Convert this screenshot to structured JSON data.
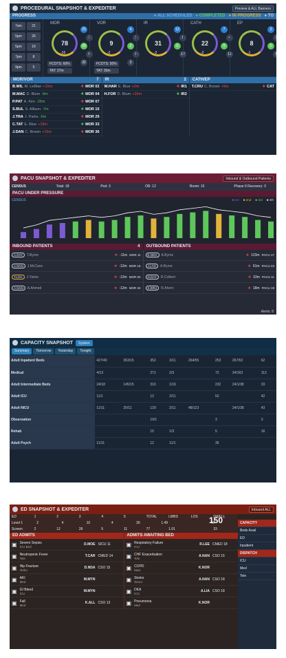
{
  "p1": {
    "title": "PROCEDURAL SNAPSHOT & EXPEDITER",
    "btn": "Preview & ALL Banners",
    "section": "PROGRESS",
    "legend": [
      "ALL SCHEDULED",
      "COMPLETED",
      "IN PROGRESS",
      "TO"
    ],
    "times": [
      [
        "7am",
        "21"
      ],
      [
        "5pm",
        "26"
      ],
      [
        "5pm",
        "16"
      ],
      [
        "7pm",
        "8"
      ],
      [
        "9pm",
        "5"
      ]
    ],
    "units": [
      {
        "name": "MOR",
        "value": "78",
        "sub": "-16",
        "chips": [
          "20",
          "1",
          "26",
          "6",
          "32"
        ],
        "tags": [
          "FCOTS: 60%",
          "TAT: 37m"
        ]
      },
      {
        "name": "VOR",
        "value": "9",
        "sub": "-2",
        "chips": [
          "4",
          "1",
          "2",
          "0",
          "3"
        ],
        "tags": [
          "FCOTS: 50%",
          "TAT: 36m"
        ]
      },
      {
        "name": "IR",
        "value": "31",
        "sub": "-2",
        "chips": [
          "12",
          "5",
          "0",
          "17"
        ],
        "tags": []
      },
      {
        "name": "CATH",
        "value": "22",
        "sub": "-2",
        "chips": [
          "7",
          "4",
          "0",
          "11"
        ],
        "tags": []
      },
      {
        "name": "EP",
        "value": "8",
        "sub": "-1",
        "chips": [
          "3",
          "1",
          "0",
          "5"
        ],
        "tags": []
      }
    ],
    "cols": [
      {
        "head": "MOR/VOR",
        "count": "7",
        "rows": [
          {
            "id": "B.WIL",
            "doc": "M. LeBlan",
            "t": "+15m",
            "room": "MOR 02"
          },
          {
            "id": "M.MAC",
            "doc": "D. Blum",
            "t": "-9m",
            "room": "MOR 04"
          },
          {
            "id": "P.PAT",
            "doc": "A. Kim",
            "t": "-25m",
            "room": "MOR 07"
          },
          {
            "id": "S.BUL",
            "doc": "S. Allison",
            "t": "-7m",
            "room": "MOR 15"
          },
          {
            "id": "J.TRA",
            "doc": "J. Parks",
            "t": "-5m",
            "room": "MOR 29"
          },
          {
            "id": "C.TAT",
            "doc": "E. Blue",
            "t": "+18m",
            "room": "MOR 33"
          },
          {
            "id": "J.DAN",
            "doc": "C. Brown",
            "t": "+15m",
            "room": "MOR 36"
          }
        ]
      },
      {
        "head": "IR",
        "count": "2",
        "rows": [
          {
            "id": "W.HAR",
            "doc": "E. Blue",
            "t": "+2m",
            "room": "IR1"
          },
          {
            "id": "H.FOR",
            "doc": "D. Blum",
            "t": "+25m",
            "room": "IR2"
          }
        ]
      },
      {
        "head": "CATH/EP",
        "count": "",
        "rows": [
          {
            "id": "T.CRU",
            "doc": "C. Brown",
            "t": "+9m",
            "room": "CAT"
          }
        ]
      }
    ]
  },
  "p2": {
    "title": "PACU SNAPSHOT & EXPEDITER",
    "btn": "Inbound & Outbound Patients",
    "census": [
      "CENSUS",
      "Total: 18",
      "Pod: 3",
      "OR: 12",
      "Room: 15",
      "Phase II Recovery: 3"
    ],
    "section": "PACU UNDER PRESSURE",
    "chart_label": "CENSUS",
    "legend": [
      "1st",
      "2nd",
      "3rd",
      "4th"
    ],
    "bars": [
      0.2,
      0.3,
      0.45,
      0.5,
      0.55,
      0.6,
      0.55,
      0.6,
      0.7,
      0.75,
      0.65,
      0.7,
      0.8,
      0.85,
      0.9,
      0.8,
      0.75,
      0.7,
      0.6,
      0.55
    ],
    "inbound_title": "INBOUND PATIENTS",
    "inbound_count": "4",
    "outbound_title": "OUTBOUND PATIENTS",
    "inbound": [
      {
        "id": "A.DAY",
        "doc": "T.Byrne",
        "time": "-11m",
        "loc": "MOR 11"
      },
      {
        "id": "A.NAN",
        "doc": "J.McCann",
        "time": "-12m",
        "loc": "MOR 15"
      },
      {
        "id": "T.LOA",
        "doc": "J.Yamis",
        "time": "-12m",
        "loc": "MOR 02"
      },
      {
        "id": "A.NAN",
        "doc": "A.Ahmed",
        "time": "-12m",
        "loc": "MOR 32"
      }
    ],
    "outbound": [
      {
        "id": "E.DEG",
        "doc": "A.Byrne",
        "time": "123m",
        "loc": "PACU 17"
      },
      {
        "id": "J.LAG",
        "doc": "A.Byrne",
        "time": "61m",
        "loc": "PACU 23"
      },
      {
        "id": "N.DAY",
        "doc": "R.Colbert",
        "time": "33m",
        "loc": "PACU 11"
      },
      {
        "id": "S.BRU",
        "doc": "R.Ahern",
        "time": "18m",
        "loc": "PACU 19"
      }
    ],
    "footer": "Alerts: 8"
  },
  "p3": {
    "title": "CAPACITY SNAPSHOT",
    "badge": "System",
    "tabs": [
      "Summary",
      "Tomorrow",
      "Yesterday",
      "Tonight"
    ],
    "rows": [
      {
        "label": "Adult Inpatient Beds",
        "v": [
          "427/40",
          "363/15",
          "352",
          "3/11",
          "264/55",
          "253",
          "267/63",
          "62"
        ]
      },
      {
        "label": "Medical",
        "v": [
          "4/13",
          "",
          "271",
          "2/3",
          "",
          "72",
          "24/163",
          "113"
        ]
      },
      {
        "label": "Adult Intermediate Beds",
        "v": [
          "24/18",
          "145/15",
          "310",
          "1/16",
          "",
          "232",
          "24/1/38",
          "33"
        ]
      },
      {
        "label": "Adult ICU",
        "v": [
          "11/1",
          "",
          "12",
          "2/11",
          "",
          "52",
          "",
          "42"
        ]
      },
      {
        "label": "Adult NICU",
        "v": [
          "11/11",
          "20/11",
          "129",
          "2/11",
          "48/123",
          "",
          "24/1/38",
          "43"
        ]
      },
      {
        "label": "Observation",
        "v": [
          "",
          "",
          "19/1",
          "",
          "",
          "3",
          "",
          "3"
        ]
      },
      {
        "label": "Rehab",
        "v": [
          "",
          "",
          "15",
          "1/3",
          "",
          "5",
          "",
          "16"
        ]
      },
      {
        "label": "Adult Psych",
        "v": [
          "11/11",
          "",
          "12",
          "11/1",
          "",
          "35",
          "",
          ""
        ]
      }
    ]
  },
  "p4": {
    "title": "ED SNAPSHOT & EXPEDITER",
    "btn": "Inbound ALL",
    "big": "150",
    "stats": [
      [
        "ED",
        "1",
        "2",
        "3",
        "4",
        "5",
        "TOTAL",
        "LWBS",
        "LOS",
        "DWELL"
      ],
      [
        "Level 1",
        "2",
        "4",
        "10",
        "4",
        "30",
        "1.49",
        "",
        "46"
      ],
      [
        "Screen",
        "2",
        "12",
        "28",
        "5",
        "11",
        "77",
        "1.01",
        "",
        "33"
      ]
    ],
    "left_title": "ED ADMITS",
    "right_title": "ADMITS AWAITING BED",
    "left": [
      {
        "name": "Severe Sepsis",
        "sub": "ICU Bed",
        "pt": "D.MOE",
        "unit": "SICU 11"
      },
      {
        "name": "Neutropenic Fever",
        "sub": "Tele",
        "pt": "T.CAR",
        "unit": "CMED 14"
      },
      {
        "name": "Hip Fracture",
        "sub": "Ortho",
        "pt": "D.NDA",
        "unit": "CSO 15"
      },
      {
        "name": "AKI",
        "sub": "Med",
        "pt": "M.MYN",
        "unit": ""
      },
      {
        "name": "GI Bleed",
        "sub": "ICU",
        "pt": "M.MYN",
        "unit": ""
      },
      {
        "name": "Fall",
        "sub": "Med",
        "pt": "K.ALL",
        "unit": "CSO 13"
      }
    ],
    "right": [
      {
        "name": "Respiratory Failure",
        "sub": "ICU",
        "pt": "R.LEE",
        "unit": "CMED 18"
      },
      {
        "name": "CHF Exacerbation",
        "sub": "Tele",
        "pt": "A.NAN",
        "unit": "CSO 15"
      },
      {
        "name": "COPD",
        "sub": "Med",
        "pt": "K.NOR",
        "unit": ""
      },
      {
        "name": "Stroke",
        "sub": "Neuro",
        "pt": "A.NAN",
        "unit": "CSO 18"
      },
      {
        "name": "DKA",
        "sub": "ICU",
        "pt": "A.LIA",
        "unit": "CSO 18"
      },
      {
        "name": "Pneumonia",
        "sub": "Med",
        "pt": "K.NOR",
        "unit": ""
      }
    ],
    "side": [
      "CAPACITY",
      "Beds Avail",
      "ED",
      "Inpatient",
      "DISPATCH",
      "ICU",
      "Med",
      "Tele"
    ]
  }
}
